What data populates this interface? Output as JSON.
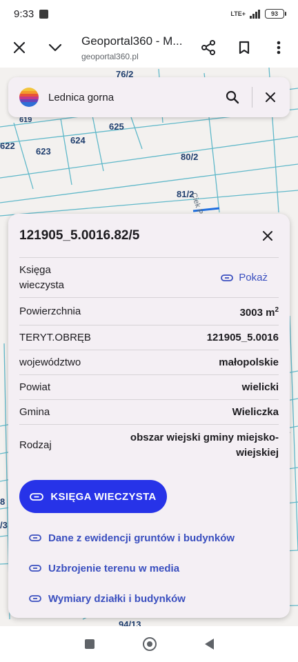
{
  "status_bar": {
    "time": "9:33",
    "network": "LTE+",
    "battery": "93"
  },
  "browser": {
    "title": "Geoportal360 - M...",
    "url": "geoportal360.pl"
  },
  "search": {
    "query": "Lednica gorna"
  },
  "map": {
    "labels": [
      "76/2",
      "619",
      "625",
      "622",
      "623",
      "624",
      "80/2",
      "81/2",
      "Ciek Podgórski",
      "94/13",
      "8",
      "/3",
      "Ci"
    ]
  },
  "panel": {
    "title": "121905_5.0016.82/5",
    "rows": {
      "ksiega": {
        "label": "Księga wieczysta",
        "action": "Pokaż"
      },
      "powierzchnia": {
        "label": "Powierzchnia",
        "value": "3003 m",
        "unit_sup": "2"
      },
      "teryt": {
        "label": "TERYT.OBRĘB",
        "value": "121905_5.0016"
      },
      "wojewodztwo": {
        "label": "województwo",
        "value": "małopolskie"
      },
      "powiat": {
        "label": "Powiat",
        "value": "wielicki"
      },
      "gmina": {
        "label": "Gmina",
        "value": "Wieliczka"
      },
      "rodzaj": {
        "label": "Rodzaj",
        "value": "obszar wiejski gminy miejsko-wiejskiej"
      }
    },
    "primary_button": "KSIĘGA WIECZYSTA",
    "links": [
      "Dane z ewidencji gruntów i budynków",
      "Uzbrojenie terenu w media",
      "Wymiary działki i budynków"
    ]
  },
  "colors": {
    "accent": "#2733e8",
    "link": "#3a4fbf",
    "parcel_line": "#5fb8c9",
    "panel_bg": "#f4eff4"
  },
  "icons": [
    "close-icon",
    "chevron-down-icon",
    "share-icon",
    "bookmark-icon",
    "more-vert-icon",
    "logo-icon",
    "search-icon",
    "link-icon"
  ]
}
